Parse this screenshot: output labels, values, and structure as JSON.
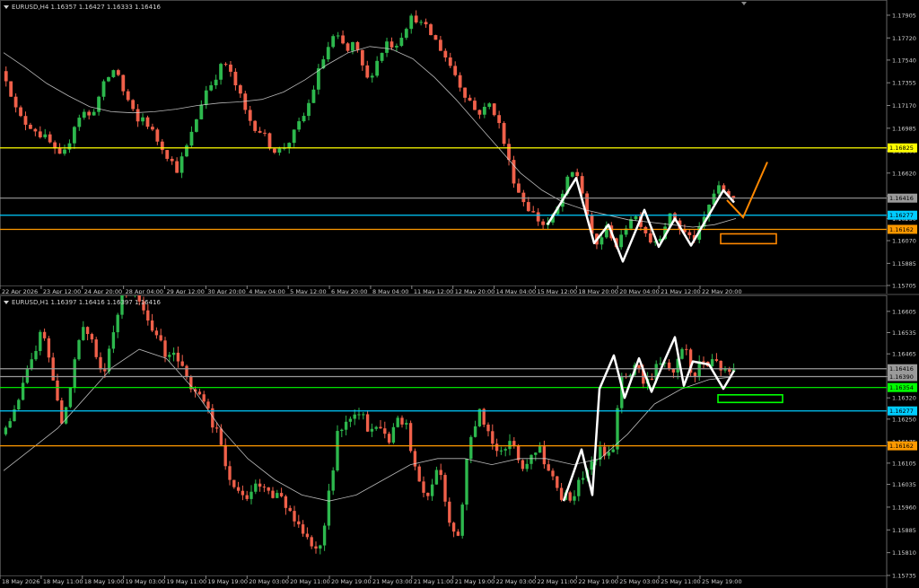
{
  "chart_data": [
    {
      "type": "candlestick",
      "symbol_header": "EURUSD,H4  1.16357 1.16427 1.16333 1.16416",
      "y_ticks": [
        "1.17905",
        "1.17720",
        "1.17540",
        "1.17355",
        "1.17170",
        "1.16985",
        "1.16800",
        "1.16620",
        "1.16435",
        "1.16250",
        "1.16070",
        "1.15885",
        "1.15705"
      ],
      "ylim": [
        1.15705,
        1.17985
      ],
      "x_labels": [
        "22 Apr 2026",
        "23 Apr 12:00",
        "24 Apr 20:00",
        "28 Apr 04:00",
        "29 Apr 12:00",
        "30 Apr 20:00",
        "4 May 04:00",
        "5 May 12:00",
        "6 May 20:00",
        "8 May 04:00",
        "11 May 12:00",
        "12 May 20:00",
        "14 May 04:00",
        "15 May 12:00",
        "18 May 20:00",
        "20 May 04:00",
        "21 May 12:00",
        "22 May 20:00"
      ],
      "levels": [
        {
          "price": 1.16825,
          "label": "1.16825",
          "color": "#ffff00"
        },
        {
          "price": 1.16416,
          "label": "1.16416",
          "color": "#9a9a9a"
        },
        {
          "price": 1.16277,
          "label": "1.16277",
          "color": "#00ccff"
        },
        {
          "price": 1.16162,
          "label": "1.16162",
          "color": "#ff9900"
        }
      ],
      "close_path": [
        1.1745,
        1.1738,
        1.1715,
        1.1705,
        1.1702,
        1.1698,
        1.1692,
        1.1688,
        1.1678,
        1.1672,
        1.1688,
        1.1705,
        1.1712,
        1.1708,
        1.1718,
        1.1732,
        1.1742,
        1.1748,
        1.1728,
        1.1718,
        1.1702,
        1.1708,
        1.1698,
        1.1689,
        1.1682,
        1.1672,
        1.1665,
        1.1678,
        1.1692,
        1.171,
        1.1728,
        1.1735,
        1.1745,
        1.1752,
        1.174,
        1.1728,
        1.1712,
        1.1702,
        1.1698,
        1.169,
        1.1682,
        1.168,
        1.1685,
        1.1692,
        1.1702,
        1.1712,
        1.173,
        1.1748,
        1.1762,
        1.1772,
        1.177,
        1.176,
        1.1768,
        1.1752,
        1.1738,
        1.1748,
        1.176,
        1.177,
        1.1765,
        1.1775,
        1.1785,
        1.179,
        1.1782,
        1.1778,
        1.177,
        1.1762,
        1.1752,
        1.1742,
        1.173,
        1.1722,
        1.1712,
        1.1712,
        1.1718,
        1.171,
        1.169,
        1.1668,
        1.165,
        1.164,
        1.1632,
        1.1625,
        1.162,
        1.1622,
        1.1632,
        1.1648,
        1.1662,
        1.166,
        1.164,
        1.161,
        1.1602,
        1.1618,
        1.1612,
        1.16,
        1.1618,
        1.1628,
        1.1625,
        1.1615,
        1.1605,
        1.161,
        1.1622,
        1.1628,
        1.1618,
        1.1612,
        1.1608,
        1.1615,
        1.163,
        1.1645,
        1.165,
        1.1646,
        1.16416
      ],
      "ma_path": [
        1.176,
        1.1748,
        1.1735,
        1.1725,
        1.1716,
        1.1712,
        1.1711,
        1.1712,
        1.1714,
        1.1717,
        1.1719,
        1.172,
        1.1722,
        1.1728,
        1.1738,
        1.175,
        1.176,
        1.1765,
        1.1763,
        1.1755,
        1.174,
        1.1722,
        1.1702,
        1.1682,
        1.1662,
        1.1648,
        1.1638,
        1.1632,
        1.1628,
        1.1624,
        1.1622,
        1.162,
        1.1618,
        1.162,
        1.1625
      ],
      "annotation_colors": {
        "zigzag": "#ffffff",
        "projection": "#ff8800",
        "target_box": "#ff8800"
      }
    },
    {
      "type": "candlestick",
      "symbol_header": "EURUSD,H1  1.16397 1.16416 1.16397 1.16416",
      "y_ticks": [
        "1.16605",
        "1.16535",
        "1.16465",
        "1.16390",
        "1.16320",
        "1.16250",
        "1.16175",
        "1.16105",
        "1.16035",
        "1.15960",
        "1.15885",
        "1.15810",
        "1.15735"
      ],
      "ylim": [
        1.15735,
        1.1664
      ],
      "x_labels": [
        "18 May 2026",
        "18 May 11:00",
        "18 May 19:00",
        "19 May 03:00",
        "19 May 11:00",
        "19 May 19:00",
        "20 May 03:00",
        "20 May 11:00",
        "20 May 19:00",
        "21 May 03:00",
        "21 May 11:00",
        "21 May 19:00",
        "22 May 03:00",
        "22 May 11:00",
        "22 May 19:00",
        "25 May 03:00",
        "25 May 11:00",
        "25 May 19:00"
      ],
      "levels": [
        {
          "price": 1.16416,
          "label": "1.16416",
          "color": "#9a9a9a"
        },
        {
          "price": 1.1639,
          "label": "1.16390",
          "color": "#9a9a9a"
        },
        {
          "price": 1.16354,
          "label": "1.16354",
          "color": "#00ff00"
        },
        {
          "price": 1.16277,
          "label": "1.16277",
          "color": "#00ccff"
        },
        {
          "price": 1.16162,
          "label": "1.16162",
          "color": "#ff9900"
        }
      ],
      "close_path": [
        1.162,
        1.1626,
        1.1634,
        1.1645,
        1.1655,
        1.164,
        1.1622,
        1.164,
        1.1655,
        1.165,
        1.164,
        1.1655,
        1.1668,
        1.1668,
        1.166,
        1.1652,
        1.1648,
        1.1645,
        1.164,
        1.1635,
        1.163,
        1.1622,
        1.1612,
        1.16,
        1.1598,
        1.1605,
        1.1602,
        1.16,
        1.1595,
        1.159,
        1.1585,
        1.158,
        1.1595,
        1.162,
        1.1625,
        1.163,
        1.1622,
        1.1625,
        1.1618,
        1.1628,
        1.162,
        1.1605,
        1.16,
        1.161,
        1.1592,
        1.1588,
        1.1618,
        1.1628,
        1.162,
        1.1612,
        1.1618,
        1.161,
        1.1612,
        1.1615,
        1.1605,
        1.16,
        1.1598,
        1.1605,
        1.161,
        1.1615,
        1.1612,
        1.164,
        1.1642,
        1.1638,
        1.164,
        1.1645,
        1.1642,
        1.165,
        1.164,
        1.1644,
        1.1645,
        1.1642,
        1.16416
      ],
      "ma_path": [
        1.1608,
        1.1615,
        1.1622,
        1.1632,
        1.1642,
        1.1648,
        1.1645,
        1.1635,
        1.1622,
        1.1612,
        1.1605,
        1.16,
        1.1598,
        1.16,
        1.1605,
        1.161,
        1.1612,
        1.1612,
        1.161,
        1.1612,
        1.1612,
        1.161,
        1.1612,
        1.162,
        1.163,
        1.1635,
        1.1638,
        1.1639
      ],
      "annotation_colors": {
        "zigzag": "#ffffff",
        "target_box": "#00ff00"
      }
    }
  ]
}
